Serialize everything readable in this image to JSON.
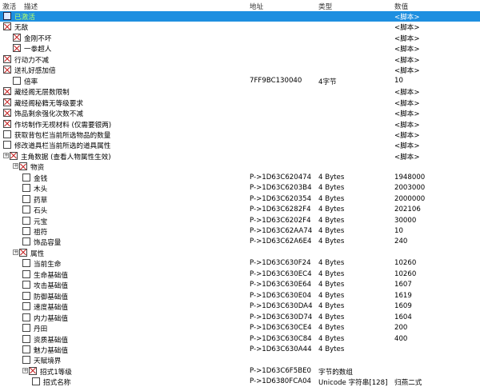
{
  "header": {
    "active": "激活",
    "desc": "描述",
    "address": "地址",
    "type": "类型",
    "value": "数值"
  },
  "rows": [
    {
      "indent": 0,
      "exp": "",
      "cb": "blue",
      "desc": "已激活",
      "addr": "",
      "type": "",
      "val": "<脚本>",
      "sel": true
    },
    {
      "indent": 0,
      "exp": "",
      "cb": "x",
      "desc": "无敌",
      "addr": "",
      "type": "",
      "val": "<脚本>"
    },
    {
      "indent": 1,
      "exp": "",
      "cb": "x",
      "desc": "金刚不坏",
      "addr": "",
      "type": "",
      "val": "<脚本>"
    },
    {
      "indent": 1,
      "exp": "",
      "cb": "x",
      "desc": "一拳超人",
      "addr": "",
      "type": "",
      "val": "<脚本>"
    },
    {
      "indent": 0,
      "exp": "",
      "cb": "x",
      "desc": "行动力不减",
      "addr": "",
      "type": "",
      "val": "<脚本>"
    },
    {
      "indent": 0,
      "exp": "",
      "cb": "x",
      "desc": "送礼好感加倍",
      "addr": "",
      "type": "",
      "val": "<脚本>"
    },
    {
      "indent": 1,
      "exp": "",
      "cb": "e",
      "desc": "倍率",
      "addr": "7FF9BC130040",
      "type": "4字节",
      "val": "10"
    },
    {
      "indent": 0,
      "exp": "",
      "cb": "x",
      "desc": "藏经阁无层数限制",
      "addr": "",
      "type": "",
      "val": "<脚本>"
    },
    {
      "indent": 0,
      "exp": "",
      "cb": "x",
      "desc": "藏经阁秘籍无等级要求",
      "addr": "",
      "type": "",
      "val": "<脚本>"
    },
    {
      "indent": 0,
      "exp": "",
      "cb": "x",
      "desc": "饰品剩余强化次数不减",
      "addr": "",
      "type": "",
      "val": "<脚本>"
    },
    {
      "indent": 0,
      "exp": "",
      "cb": "x",
      "desc": "作坊制作无视材料 (仅需要银两)",
      "addr": "",
      "type": "",
      "val": "<脚本>"
    },
    {
      "indent": 0,
      "exp": "",
      "cb": "e",
      "desc": "获取背包栏当前所选物品的数量",
      "addr": "",
      "type": "",
      "val": "<脚本>"
    },
    {
      "indent": 0,
      "exp": "",
      "cb": "e",
      "desc": "修改道具栏当前所选的道具属性",
      "addr": "",
      "type": "",
      "val": "<脚本>"
    },
    {
      "indent": 0,
      "exp": "+",
      "cb": "x",
      "desc": "主角数据 (查看人物属性生效)",
      "addr": "",
      "type": "",
      "val": "<脚本>"
    },
    {
      "indent": 1,
      "exp": "+",
      "cb": "x",
      "desc": "物资",
      "addr": "",
      "type": "",
      "val": ""
    },
    {
      "indent": 2,
      "exp": "",
      "cb": "e",
      "desc": "金钱",
      "addr": "P->1D63C620474",
      "type": "4 Bytes",
      "val": "1948000"
    },
    {
      "indent": 2,
      "exp": "",
      "cb": "e",
      "desc": "木头",
      "addr": "P->1D63C6203B4",
      "type": "4 Bytes",
      "val": "2003000"
    },
    {
      "indent": 2,
      "exp": "",
      "cb": "e",
      "desc": "药草",
      "addr": "P->1D63C620354",
      "type": "4 Bytes",
      "val": "2000000"
    },
    {
      "indent": 2,
      "exp": "",
      "cb": "e",
      "desc": "石头",
      "addr": "P->1D63C6282F4",
      "type": "4 Bytes",
      "val": "202106"
    },
    {
      "indent": 2,
      "exp": "",
      "cb": "e",
      "desc": "元宝",
      "addr": "P->1D63C6202F4",
      "type": "4 Bytes",
      "val": "30000"
    },
    {
      "indent": 2,
      "exp": "",
      "cb": "e",
      "desc": "祖符",
      "addr": "P->1D63C62AA74",
      "type": "4 Bytes",
      "val": "10"
    },
    {
      "indent": 2,
      "exp": "",
      "cb": "e",
      "desc": "饰品容量",
      "addr": "P->1D63C62A6E4",
      "type": "4 Bytes",
      "val": "240"
    },
    {
      "indent": 1,
      "exp": "+",
      "cb": "x",
      "desc": "属性",
      "addr": "",
      "type": "",
      "val": ""
    },
    {
      "indent": 2,
      "exp": "",
      "cb": "e",
      "desc": "当前生命",
      "addr": "P->1D63C630F24",
      "type": "4 Bytes",
      "val": "10260"
    },
    {
      "indent": 2,
      "exp": "",
      "cb": "e",
      "desc": "生命基础值",
      "addr": "P->1D63C630EC4",
      "type": "4 Bytes",
      "val": "10260"
    },
    {
      "indent": 2,
      "exp": "",
      "cb": "e",
      "desc": "攻击基础值",
      "addr": "P->1D63C630E64",
      "type": "4 Bytes",
      "val": "1607"
    },
    {
      "indent": 2,
      "exp": "",
      "cb": "e",
      "desc": "防御基础值",
      "addr": "P->1D63C630E04",
      "type": "4 Bytes",
      "val": "1619"
    },
    {
      "indent": 2,
      "exp": "",
      "cb": "e",
      "desc": "速度基础值",
      "addr": "P->1D63C630DA4",
      "type": "4 Bytes",
      "val": "1609"
    },
    {
      "indent": 2,
      "exp": "",
      "cb": "e",
      "desc": "内力基础值",
      "addr": "P->1D63C630D74",
      "type": "4 Bytes",
      "val": "1604"
    },
    {
      "indent": 2,
      "exp": "",
      "cb": "e",
      "desc": "丹田",
      "addr": "P->1D63C630CE4",
      "type": "4 Bytes",
      "val": "200"
    },
    {
      "indent": 2,
      "exp": "",
      "cb": "e",
      "desc": "资质基础值",
      "addr": "P->1D63C630C84",
      "type": "4 Bytes",
      "val": "400"
    },
    {
      "indent": 2,
      "exp": "",
      "cb": "e",
      "desc": "魅力基础值",
      "addr": "P->1D63C630A44",
      "type": "4 Bytes",
      "val": ""
    },
    {
      "indent": 2,
      "exp": "",
      "cb": "e",
      "desc": "天赋境界",
      "addr": "",
      "type": "",
      "val": ""
    },
    {
      "indent": 2,
      "exp": "+",
      "cb": "x",
      "desc": "招式1等级",
      "addr": "P->1D63C6F5BE0",
      "type": "字节的数组",
      "val": ""
    },
    {
      "indent": 3,
      "exp": "",
      "cb": "e",
      "desc": "招式名称",
      "addr": "P->1D6380FCA04",
      "type": "Unicode 字符串[128]",
      "val": "归燕二式"
    }
  ]
}
